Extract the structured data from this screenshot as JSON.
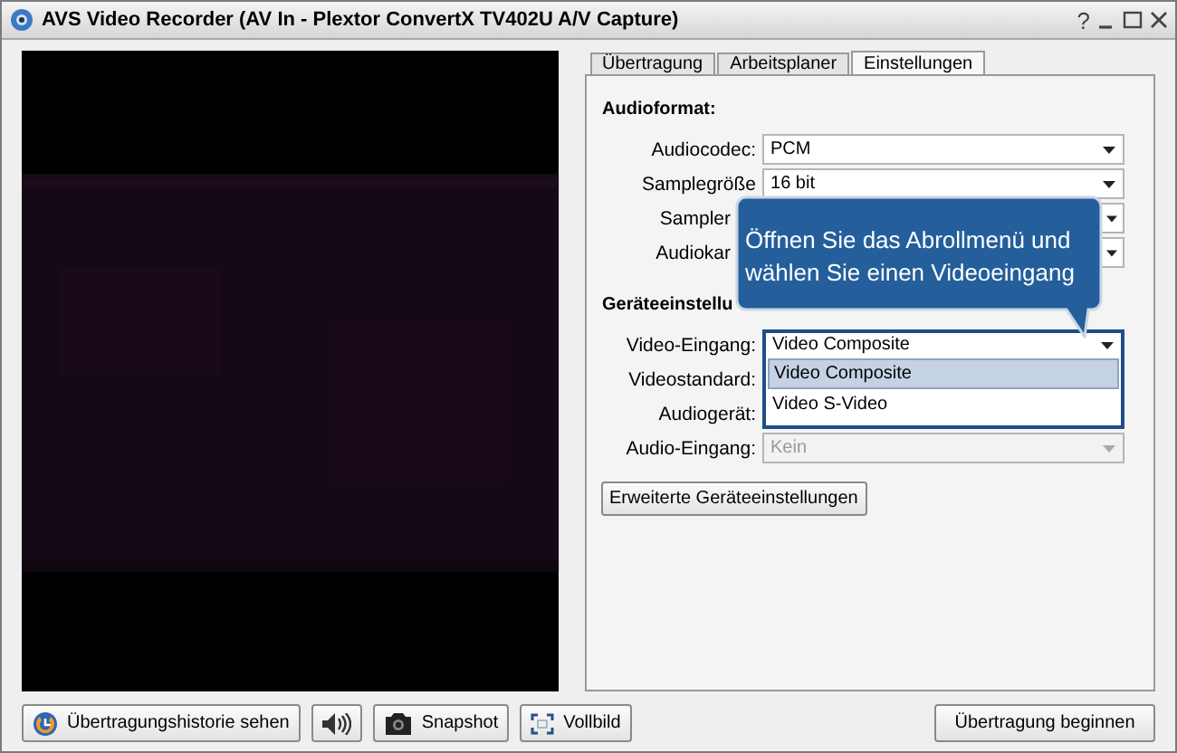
{
  "window": {
    "title": "AVS Video Recorder (AV In - Plextor ConvertX TV402U A/V Capture)",
    "help": "?"
  },
  "tabs": [
    {
      "label": "Übertragung",
      "selected": false
    },
    {
      "label": "Arbeitsplaner",
      "selected": false
    },
    {
      "label": "Einstellungen",
      "selected": true
    }
  ],
  "sections": [
    {
      "title": "Audioformat:",
      "fields": [
        {
          "label": "Audiocodec:",
          "value": "PCM",
          "covered": false,
          "expanded": false,
          "disabled": false
        },
        {
          "label": "Samplegröße",
          "value": "16 bit",
          "covered": false,
          "expanded": false,
          "disabled": false
        },
        {
          "label": "Sampler",
          "covered": true,
          "kind": "edge",
          "expanded": false,
          "disabled": false
        },
        {
          "label": "Audiokar",
          "covered": true,
          "kind": "edge",
          "expanded": false,
          "disabled": false
        }
      ]
    },
    {
      "title": "Geräteeinstellu",
      "fields": [
        {
          "label": "Video-Eingang:",
          "value": "Video Composite",
          "covered": false,
          "expanded": true,
          "disabled": false,
          "options": [
            {
              "label": "Video Composite",
              "selected": true
            },
            {
              "label": "Video S-Video",
              "selected": false
            }
          ]
        },
        {
          "label": "Videostandard:",
          "covered": false,
          "kind": "hidden"
        },
        {
          "label": "Audiogerät:",
          "covered": false,
          "kind": "hidden"
        },
        {
          "label": "Audio-Eingang:",
          "value": "Kein",
          "covered": false,
          "expanded": false,
          "disabled": true
        }
      ],
      "button": "Erweiterte Geräteeinstellungen"
    }
  ],
  "callout": {
    "text": "Öffnen Sie das Abrollmenü und\nwählen Sie einen Videoeingang"
  },
  "toolbar": [
    {
      "kind": "history",
      "label": "Übertragungshistorie sehen"
    },
    {
      "kind": "sound"
    },
    {
      "kind": "snapshot",
      "label": "Snapshot"
    },
    {
      "kind": "fullscreen",
      "label": "Vollbild"
    }
  ],
  "start_button": "Übertragung beginnen"
}
